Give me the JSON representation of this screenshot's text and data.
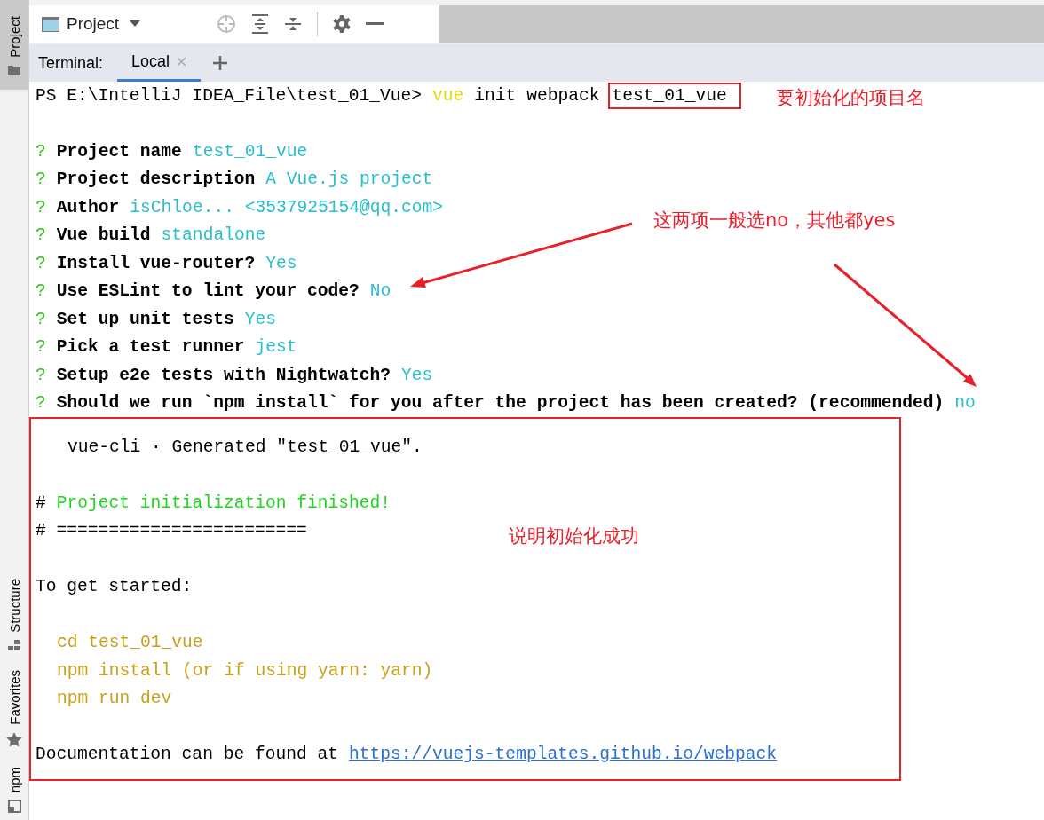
{
  "side_tabs": [
    {
      "label": "Project",
      "selected": true
    },
    {
      "label": "Structure",
      "selected": false
    },
    {
      "label": "Favorites",
      "selected": false
    },
    {
      "label": "npm",
      "selected": false
    }
  ],
  "panel": {
    "title": "Project"
  },
  "terminal": {
    "label": "Terminal:",
    "tabs": [
      {
        "label": "Local",
        "selected": true
      }
    ]
  },
  "prompt": {
    "path": "PS E:\\IntelliJ IDEA_File\\test_01_Vue>",
    "command": "vue",
    "args": "init webpack",
    "project": "test_01_vue"
  },
  "questions": [
    {
      "mark": "?",
      "question": "Project name",
      "answer": "test_01_vue"
    },
    {
      "mark": "?",
      "question": "Project description",
      "answer": "A Vue.js project"
    },
    {
      "mark": "?",
      "question": "Author",
      "answer": "isChloe... <3537925154@qq.com>"
    },
    {
      "mark": "?",
      "question": "Vue build",
      "answer": "standalone"
    },
    {
      "mark": "?",
      "question": "Install vue-router?",
      "answer": "Yes"
    },
    {
      "mark": "?",
      "question": "Use ESLint to lint your code?",
      "answer": "No"
    },
    {
      "mark": "?",
      "question": "Set up unit tests",
      "answer": "Yes"
    },
    {
      "mark": "?",
      "question": "Pick a test runner",
      "answer": "jest"
    },
    {
      "mark": "?",
      "question": "Setup e2e tests with Nightwatch?",
      "answer": "Yes"
    },
    {
      "mark": "?",
      "question": "Should we run `npm install` for you after the project has been created? (recommended)",
      "answer": "no"
    }
  ],
  "output": [
    {
      "kind": "banner",
      "text": "vue-cli · Generated \"test_01_vue\"."
    },
    {
      "kind": "blank"
    },
    {
      "kind": "heading",
      "mark": "#",
      "text": "Project initialization finished!"
    },
    {
      "kind": "plain",
      "text": "# ========================"
    },
    {
      "kind": "blank"
    },
    {
      "kind": "plain",
      "text": "To get started:"
    },
    {
      "kind": "blank"
    },
    {
      "kind": "command",
      "text": "cd test_01_vue"
    },
    {
      "kind": "command",
      "text": "npm install (or if using yarn: yarn)"
    },
    {
      "kind": "command",
      "text": "npm run dev"
    },
    {
      "kind": "blank"
    },
    {
      "kind": "doc",
      "text": "Documentation can be found at",
      "link": "https://vuejs-templates.github.io/webpack"
    }
  ],
  "annotations": [
    {
      "kind": "name",
      "text": "要初始化的项目名"
    },
    {
      "kind": "choice",
      "text": "这两项一般选no，其他都yes"
    },
    {
      "kind": "success",
      "text": "说明初始化成功"
    }
  ]
}
